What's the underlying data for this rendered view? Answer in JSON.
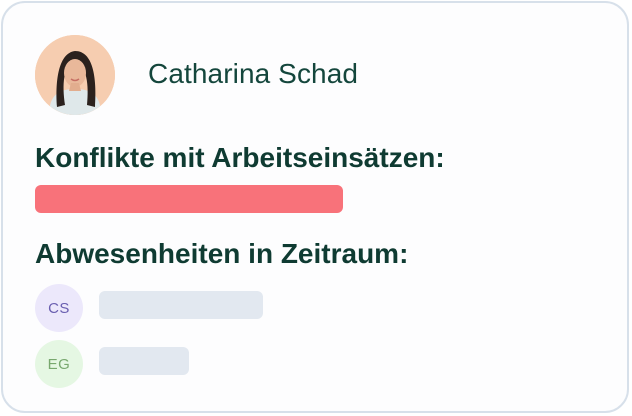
{
  "person": {
    "name": "Catharina Schad"
  },
  "sections": {
    "conflicts_title": "Konflikte mit Arbeitseinsätzen:",
    "absences_title": "Abwesenheiten in Zeitraum:"
  },
  "absences": [
    {
      "initials": "CS"
    },
    {
      "initials": "EG"
    }
  ],
  "colors": {
    "conflict": "#f8727a",
    "placeholder": "#e2e8f0",
    "heading": "#0f3b32"
  }
}
